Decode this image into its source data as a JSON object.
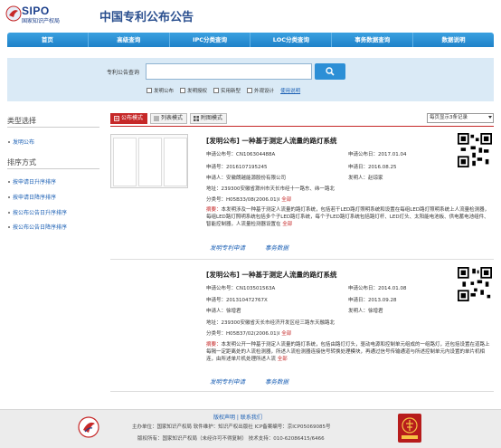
{
  "header": {
    "logo_text": "SIPO",
    "logo_org": "国家知识产权局",
    "site_title": "中国专利公布公告"
  },
  "nav": {
    "items": [
      "首页",
      "高级查询",
      "IPC分类查询",
      "LOC分类查询",
      "事务数据查询",
      "数据说明"
    ]
  },
  "search": {
    "label": "专利公告查询",
    "query_value": "",
    "filters": [
      "发明公布",
      "发明授权",
      "实用新型",
      "外观设计"
    ],
    "usage_link": "使用说明"
  },
  "sidebar": {
    "type_heading": "类型选择",
    "type_items": [
      "发明公布"
    ],
    "sort_heading": "排序方式",
    "sort_items": [
      "按申请日升序排序",
      "按申请日降序排序",
      "按公布公告日升序排序",
      "按公布公告日降序排序"
    ]
  },
  "toolbar": {
    "view_modes": [
      "公布模式",
      "列表模式",
      "附图模式"
    ],
    "page_size": "每页显示3条记录"
  },
  "records": [
    {
      "title": "[发明公布] 一种基于测定人流量的路灯系统",
      "pub_no_label": "申请公布号：",
      "pub_no": "CN106304488A",
      "pub_date_label": "申请公布日：",
      "pub_date": "2017.01.04",
      "app_no_label": "申请号：",
      "app_no": "2016107195245",
      "app_date_label": "申请日：",
      "app_date": "2016.08.25",
      "applicant_label": "申请人：",
      "applicant": "安徽朗越能源股份有限公司",
      "inventor_label": "发明人：",
      "inventor": "赵琼家",
      "address_label": "地址：",
      "address": "239300安徽省滁州市天长市经十一路东、纬一路北",
      "class_label": "分类号：",
      "class_no": "H05B33/08(2006.01)I",
      "class_all": "全部",
      "abstract_label": "摘要：",
      "abstract": "本发明涉及一种基于测定人流量的路灯系统，包括若干LED路灯照明系统和设置在每组LED路灯照明系统上人流量检测器，每组LED路灯照明系统包括多个子LED路灯系统，每个子LED路灯系统包括路灯杆、LED灯头、太阳能电池板、供电蓄电池组件、智能控制器，人流量检测器设置在",
      "abstract_more": "全部",
      "op_claims": "发明专利申请",
      "op_data": "事务数据"
    },
    {
      "title": "[发明公布] 一种基于测定人流量的路灯系统",
      "pub_no_label": "申请公布号：",
      "pub_no": "CN103501563A",
      "pub_date_label": "申请公布日：",
      "pub_date": "2014.01.08",
      "app_no_label": "申请号：",
      "app_no": "201310472767X",
      "app_date_label": "申请日：",
      "app_date": "2013.09.28",
      "applicant_label": "申请人：",
      "applicant": "徐增君",
      "inventor_label": "发明人：",
      "inventor": "徐增君",
      "address_label": "地址：",
      "address": "239300安徽省天长市经济开发区经三路东天融路北",
      "class_label": "分类号：",
      "class_no": "H05B37/02(2006.01)I",
      "class_all": "全部",
      "abstract_label": "摘要：",
      "abstract": "本发明公开一种基于测定人流量的路灯系统，包括由路灯灯头，驱动电源和控制单元组成的一组路灯，还包括设置在道路上每隔一定距离处的人流检测器，所述人流检测器连接信号转换处理模块，再通过信号传输通道与所述控制单元内设置的单片机相连，由所述单片机处理所述人流",
      "abstract_more": "全部",
      "op_claims": "发明专利申请",
      "op_data": "事务数据"
    }
  ],
  "footer": {
    "links": "版权声明 | 联系我们",
    "line1": "主办单位：国家知识产权局   软件维护：知识产权出版社   ICP备案编号：京ICP05069085号",
    "line2": "版权所有：国家知识产权局（未经许可不得复制）   技术支持：010-62086415/6466"
  },
  "colors": {
    "nav_blue": "#2a8ed5",
    "accent_red": "#c62828",
    "link_blue": "#1a5fb4",
    "search_band": "#daeaf6"
  }
}
